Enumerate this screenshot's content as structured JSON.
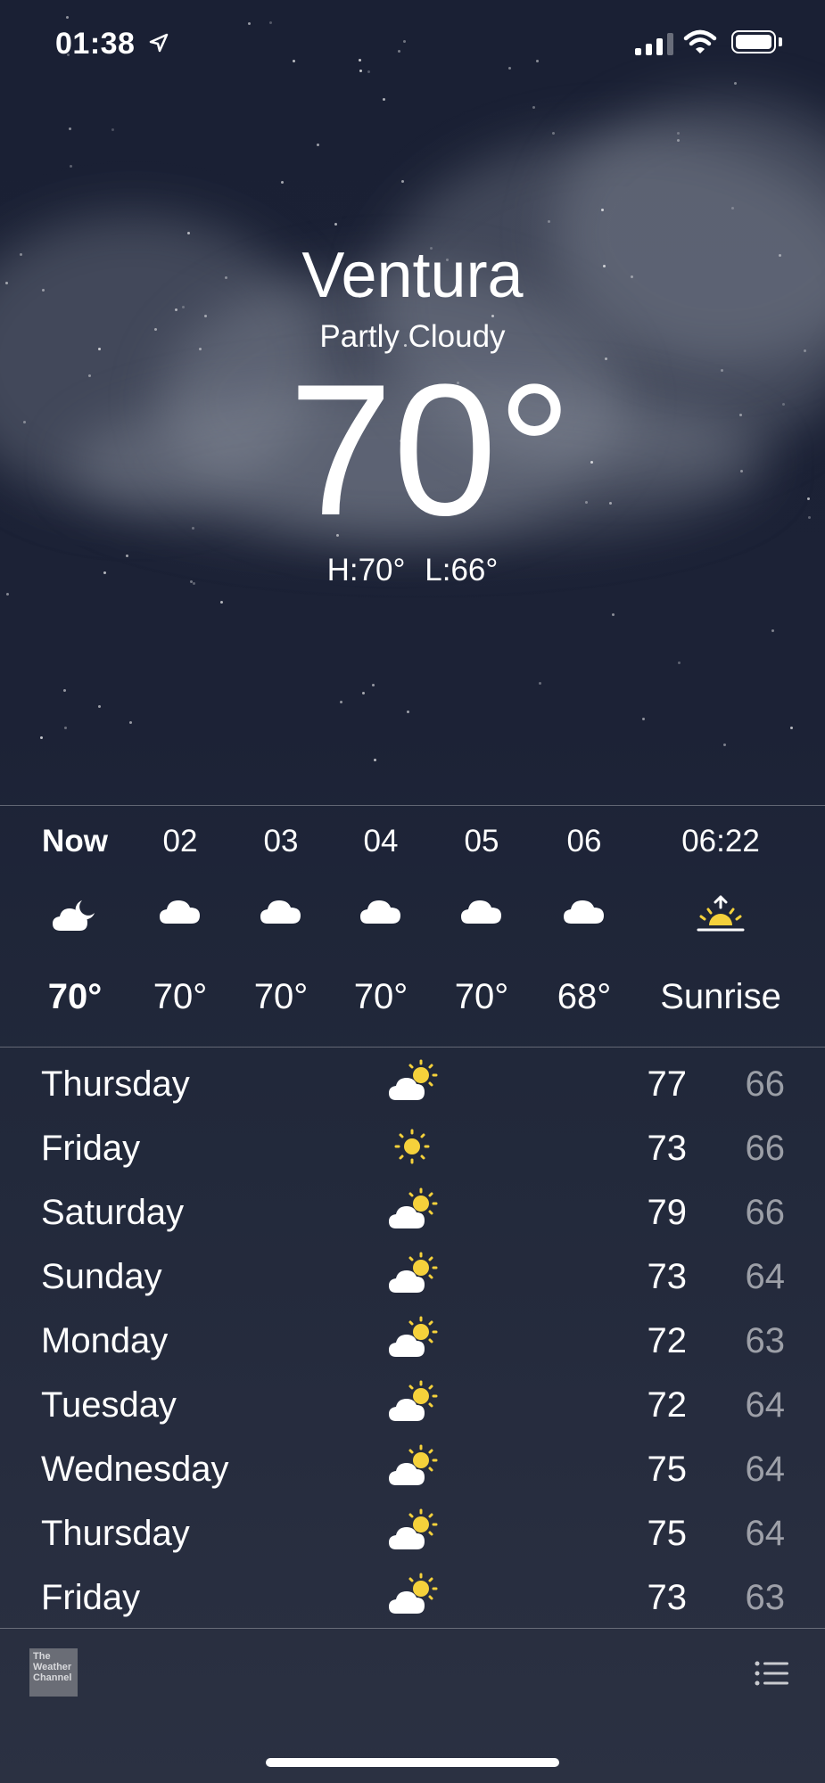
{
  "status_bar": {
    "time": "01:38"
  },
  "location": {
    "city": "Ventura",
    "condition": "Partly Cloudy",
    "temperature": "70°",
    "high": "H:70°",
    "low": "L:66°"
  },
  "hourly": [
    {
      "label": "Now",
      "icon": "moon-cloud-icon",
      "temp": "70°"
    },
    {
      "label": "02",
      "icon": "cloud-icon",
      "temp": "70°"
    },
    {
      "label": "03",
      "icon": "cloud-icon",
      "temp": "70°"
    },
    {
      "label": "04",
      "icon": "cloud-icon",
      "temp": "70°"
    },
    {
      "label": "05",
      "icon": "cloud-icon",
      "temp": "70°"
    },
    {
      "label": "06",
      "icon": "cloud-icon",
      "temp": "68°"
    },
    {
      "label": "06:22",
      "icon": "sunrise-icon",
      "temp": "Sunrise"
    }
  ],
  "daily": [
    {
      "day": "Thursday",
      "icon": "partly-sunny-icon",
      "high": "77",
      "low": "66"
    },
    {
      "day": "Friday",
      "icon": "sun-icon",
      "high": "73",
      "low": "66"
    },
    {
      "day": "Saturday",
      "icon": "partly-sunny-icon",
      "high": "79",
      "low": "66"
    },
    {
      "day": "Sunday",
      "icon": "partly-sunny-icon",
      "high": "73",
      "low": "64"
    },
    {
      "day": "Monday",
      "icon": "partly-sunny-icon",
      "high": "72",
      "low": "63"
    },
    {
      "day": "Tuesday",
      "icon": "partly-sunny-icon",
      "high": "72",
      "low": "64"
    },
    {
      "day": "Wednesday",
      "icon": "partly-sunny-icon",
      "high": "75",
      "low": "64"
    },
    {
      "day": "Thursday",
      "icon": "partly-sunny-icon",
      "high": "75",
      "low": "64"
    },
    {
      "day": "Friday",
      "icon": "partly-sunny-icon",
      "high": "73",
      "low": "63"
    }
  ],
  "footer": {
    "logo_lines": [
      "The",
      "Weather",
      "Channel"
    ]
  },
  "colors": {
    "sun": "#f5d13b",
    "text": "#ffffff",
    "low_temp": "rgba(255,255,255,0.55)"
  }
}
